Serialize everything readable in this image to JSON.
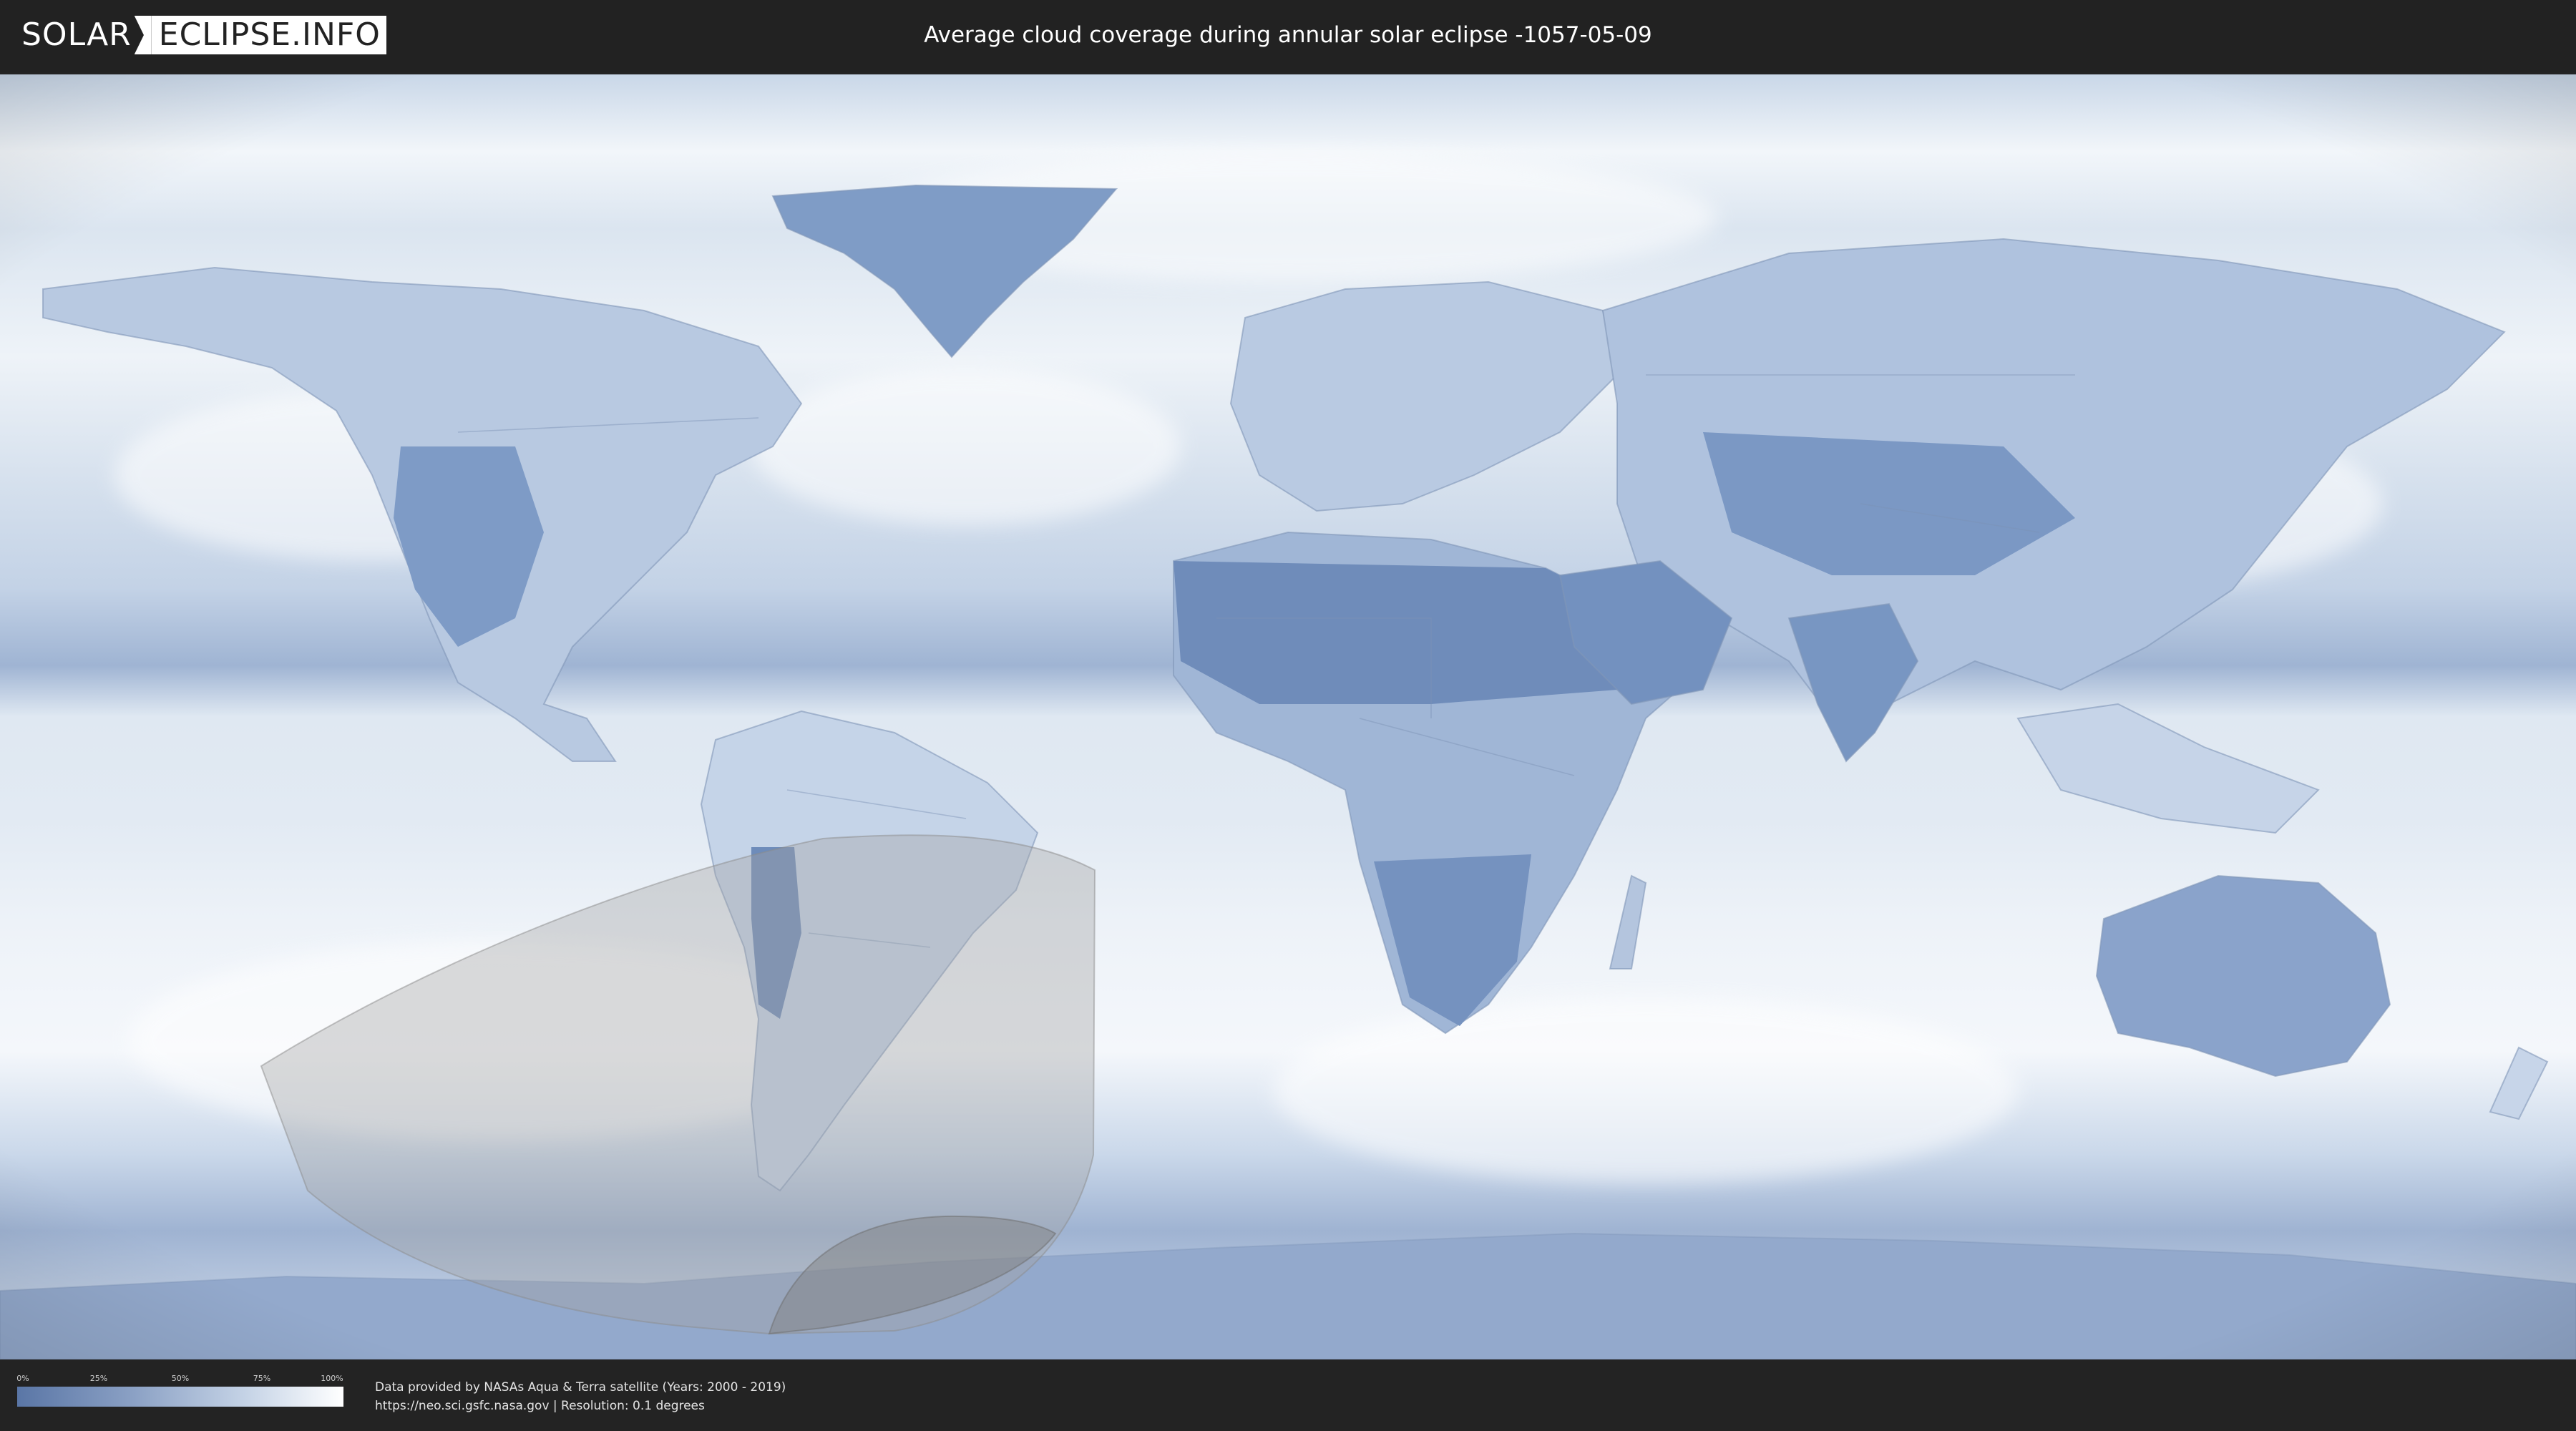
{
  "header": {
    "logo": {
      "left_text": "SOLAR",
      "right_text": "ECLIPSE.INFO"
    },
    "title": "Average cloud coverage during annular solar eclipse -1057-05-09"
  },
  "map": {
    "projection": "equirectangular",
    "colors": {
      "ocean_cloud": "#e6edf5",
      "clear_land": "#6f8bb4",
      "shadow_path": "#a9a9a9",
      "border": "#8da2c0"
    },
    "eclipse": {
      "type": "annular",
      "date": "-1057-05-09"
    }
  },
  "legend": {
    "ticks": [
      "0%",
      "25%",
      "50%",
      "75%",
      "100%"
    ],
    "color_start": "#5a76a6",
    "color_end": "#ffffff"
  },
  "credits": {
    "line1": "Data provided by NASAs Aqua & Terra satellite (Years: 2000 - 2019)",
    "line2": "https://neo.sci.gsfc.nasa.gov | Resolution: 0.1 degrees"
  }
}
